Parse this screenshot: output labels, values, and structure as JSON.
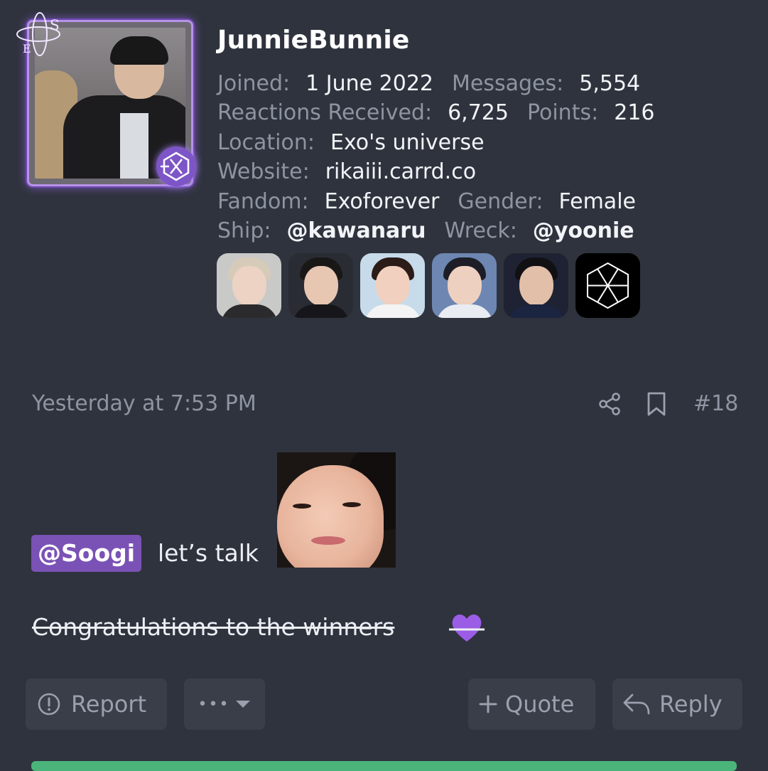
{
  "profile": {
    "username": "JunnieBunnie",
    "joined_label": "Joined:",
    "joined_value": "1 June 2022",
    "messages_label": "Messages:",
    "messages_value": "5,554",
    "reactions_label": "Reactions Received:",
    "reactions_value": "6,725",
    "points_label": "Points:",
    "points_value": "216",
    "location_label": "Location:",
    "location_value": "Exo's universe",
    "website_label": "Website:",
    "website_value": "rikaiii.carrd.co",
    "fandom_label": "Fandom:",
    "fandom_value": "Exoforever",
    "gender_label": "Gender:",
    "gender_value": "Female",
    "ship_label": "Ship:",
    "ship_value": "@kawanaru",
    "wreck_label": "Wreck:",
    "wreck_value": "@yoonie"
  },
  "post": {
    "timestamp": "Yesterday at 7:53 PM",
    "post_number": "#18",
    "mention": "@Soogi",
    "body_text": "let’s talk",
    "struck_text": "Congratulations to the winners"
  },
  "actions": {
    "report": "Report",
    "more": "•••",
    "quote": "Quote",
    "reply": "Reply"
  },
  "colors": {
    "background": "#2f333d",
    "muted_text": "#8e94a1",
    "mention_bg": "#7a52b5",
    "button_bg": "#3a3e48",
    "accent_green": "#4bb47a",
    "avatar_glow": "#b693e6"
  },
  "icons": {
    "share": "share-icon",
    "bookmark": "bookmark-icon",
    "report": "alert-circle-icon",
    "more": "caret-down-icon",
    "quote": "plus-icon",
    "reply": "reply-arrow-icon",
    "heart": "purple-heart-icon",
    "exo_logo": "exo-hexagon-logo-icon"
  }
}
